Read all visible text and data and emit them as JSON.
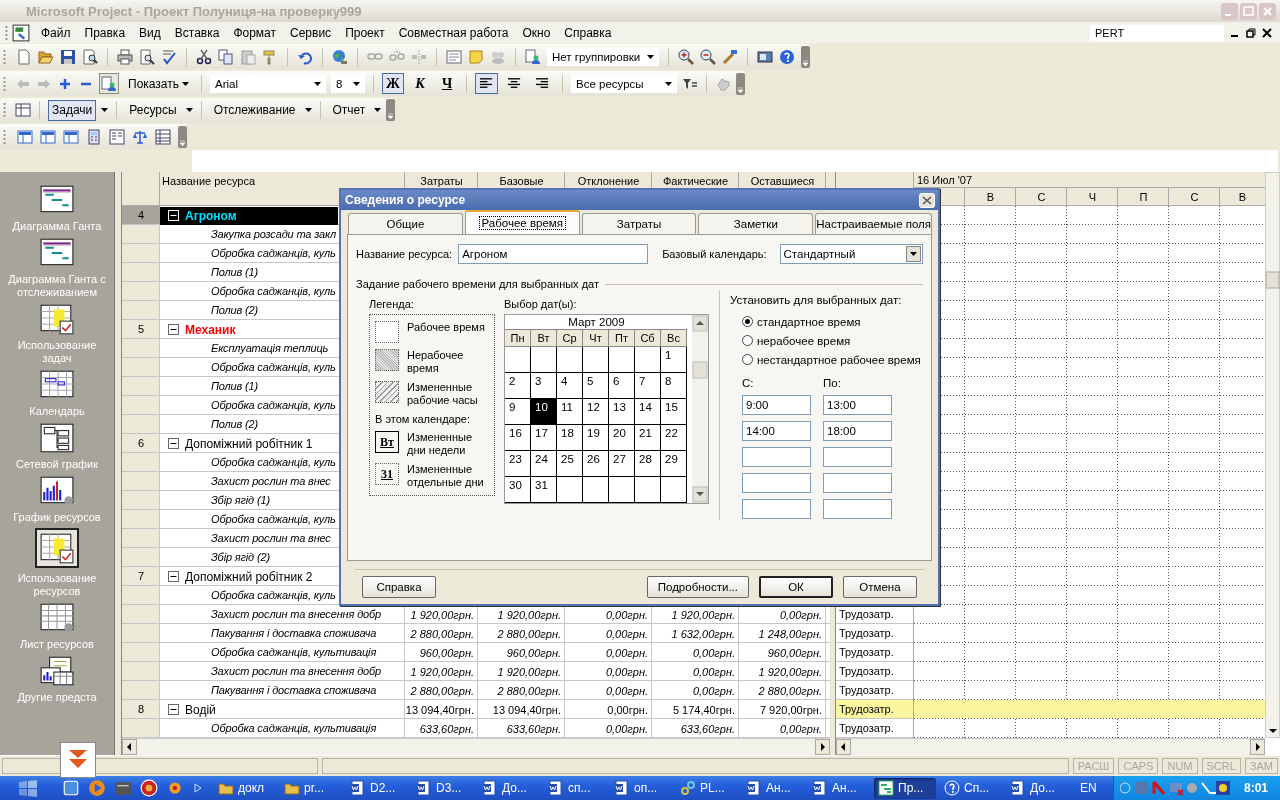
{
  "window": {
    "title": "Microsoft Project - Проект Полуниця-на проверку999"
  },
  "menu": [
    "Файл",
    "Правка",
    "Вид",
    "Вставка",
    "Формат",
    "Сервис",
    "Проект",
    "Совместная работа",
    "Окно",
    "Справка"
  ],
  "help_box": {
    "value": "PERT"
  },
  "toolbars": {
    "grouping": {
      "value": "Нет группировки"
    },
    "show_button": "Показать",
    "font": {
      "value": "Arial"
    },
    "font_size": {
      "value": "8"
    },
    "format_buttons": [
      {
        "label": "Ж",
        "kind": "bold",
        "pressed": true
      },
      {
        "label": "К",
        "kind": "italic",
        "pressed": false
      },
      {
        "label": "Ч",
        "kind": "underline",
        "pressed": false
      }
    ],
    "align_buttons": [
      {
        "kind": "left",
        "pressed": true
      },
      {
        "kind": "center",
        "pressed": false
      },
      {
        "kind": "right",
        "pressed": false
      }
    ],
    "filter": {
      "value": "Все ресурсы"
    },
    "guide_buttons": [
      {
        "label": "Задачи",
        "selected": true
      },
      {
        "label": "Ресурсы",
        "selected": false
      },
      {
        "label": "Отслеживание",
        "selected": false
      },
      {
        "label": "Отчет",
        "selected": false
      }
    ]
  },
  "view_bar": {
    "items": [
      {
        "label": "Диаграмма Ганта",
        "kind": "gantt",
        "selected": false
      },
      {
        "label": "Диаграмма Ганта с отслеживанием",
        "kind": "gantt",
        "selected": false
      },
      {
        "label": "Использование задач",
        "kind": "usage",
        "selected": false
      },
      {
        "label": "Календарь",
        "kind": "calendar",
        "selected": false
      },
      {
        "label": "Сетевой график",
        "kind": "network",
        "selected": false
      },
      {
        "label": "График ресурсов",
        "kind": "graph",
        "selected": false
      },
      {
        "label": "Использование ресурсов",
        "kind": "usage",
        "selected": true
      },
      {
        "label": "Лист ресурсов",
        "kind": "sheet",
        "selected": false
      },
      {
        "label": "Другие предста",
        "kind": "other",
        "selected": false
      }
    ]
  },
  "sheet": {
    "columns": [
      "Название ресурса",
      "Затраты",
      "Базовые",
      "Отклонение",
      "Фактические",
      "Оставшиеся"
    ],
    "rows": [
      {
        "kind": "resource",
        "number": "4",
        "name": "Агроном",
        "selected": true,
        "overallocated": true,
        "highlighted": false
      },
      {
        "kind": "assignment",
        "name": "Закупка розсади та закл",
        "selected": false,
        "highlighted": false
      },
      {
        "kind": "assignment",
        "name": "Обробка саджанців, куль",
        "selected": false,
        "highlighted": false
      },
      {
        "kind": "assignment",
        "name": "Полив (1)",
        "selected": false,
        "highlighted": false
      },
      {
        "kind": "assignment",
        "name": "Обробка саджанців, куль",
        "selected": false,
        "highlighted": false
      },
      {
        "kind": "assignment",
        "name": "Полив  (2)",
        "selected": false,
        "highlighted": false
      },
      {
        "kind": "resource",
        "number": "5",
        "name": "Механик",
        "selected": false,
        "overallocated": true,
        "highlighted": false
      },
      {
        "kind": "assignment",
        "name": "Експлуатація теплиць",
        "selected": false,
        "highlighted": false
      },
      {
        "kind": "assignment",
        "name": "Обробка саджанців, куль",
        "selected": false,
        "highlighted": false
      },
      {
        "kind": "assignment",
        "name": "Полив (1)",
        "selected": false,
        "highlighted": false
      },
      {
        "kind": "assignment",
        "name": "Обробка саджанців, куль",
        "selected": false,
        "highlighted": false
      },
      {
        "kind": "assignment",
        "name": "Полив  (2)",
        "selected": false,
        "highlighted": false
      },
      {
        "kind": "resource",
        "number": "6",
        "name": "Допоміжний робітник 1",
        "selected": false,
        "overallocated": false,
        "highlighted": false
      },
      {
        "kind": "assignment",
        "name": "Обробка саджанців, куль",
        "selected": false,
        "highlighted": false
      },
      {
        "kind": "assignment",
        "name": "Захист рослин та внес",
        "selected": false,
        "highlighted": false
      },
      {
        "kind": "assignment",
        "name": "Збір ягід (1)",
        "selected": false,
        "highlighted": false
      },
      {
        "kind": "assignment",
        "name": "Обробка саджанців, куль",
        "selected": false,
        "highlighted": false
      },
      {
        "kind": "assignment",
        "name": "Захист рослин та внес",
        "selected": false,
        "highlighted": false
      },
      {
        "kind": "assignment",
        "name": "Збір ягід  (2)",
        "selected": false,
        "highlighted": false
      },
      {
        "kind": "resource",
        "number": "7",
        "name": "Допоміжний робітник 2",
        "selected": false,
        "overallocated": false,
        "highlighted": false
      },
      {
        "kind": "assignment",
        "name": "Обробка саджанців, куль",
        "selected": false,
        "highlighted": false
      },
      {
        "kind": "assignment",
        "name": "Захист рослин та внесення добр",
        "selected": false,
        "values": [
          "1 920,00грн.",
          "1 920,00грн.",
          "0,00грн.",
          "1 920,00грн.",
          "0,00грн."
        ],
        "work": "Трудозатр.",
        "highlighted": false
      },
      {
        "kind": "assignment",
        "name": "Пакування  і доставка споживача",
        "selected": false,
        "values": [
          "2 880,00грн.",
          "2 880,00грн.",
          "0,00грн.",
          "1 632,00грн.",
          "1 248,00грн."
        ],
        "work": "Трудозатр.",
        "highlighted": false
      },
      {
        "kind": "assignment",
        "name": "Обробка саджанців, культивація",
        "selected": false,
        "values": [
          "960,00грн.",
          "960,00грн.",
          "0,00грн.",
          "0,00грн.",
          "960,00грн."
        ],
        "work": "Трудозатр.",
        "highlighted": false
      },
      {
        "kind": "assignment",
        "name": "Захист рослин та внесення добр",
        "selected": false,
        "values": [
          "1 920,00грн.",
          "1 920,00грн.",
          "0,00грн.",
          "0,00грн.",
          "1 920,00грн."
        ],
        "work": "Трудозатр.",
        "highlighted": false
      },
      {
        "kind": "assignment",
        "name": "Пакування  і доставка споживача",
        "selected": false,
        "values": [
          "2 880,00грн.",
          "2 880,00грн.",
          "0,00грн.",
          "0,00грн.",
          "2 880,00грн."
        ],
        "work": "Трудозатр.",
        "highlighted": false
      },
      {
        "kind": "resource",
        "number": "8",
        "name": "Водій",
        "selected": false,
        "overallocated": false,
        "values": [
          "13 094,40грн.",
          "13 094,40грн.",
          "0,00грн.",
          "5 174,40грн.",
          "7 920,00грн."
        ],
        "work": "Трудозатр.",
        "highlighted": true
      },
      {
        "kind": "assignment",
        "name": "Обробка саджанців, культивація",
        "selected": false,
        "values": [
          "633,60грн.",
          "633,60грн.",
          "0,00грн.",
          "633,60грн.",
          "0,00грн."
        ],
        "work": "Трудозатр.",
        "highlighted": false
      }
    ]
  },
  "usage": {
    "date": "16 Июл '07",
    "days": [
      "В",
      "С",
      "Ч",
      "П",
      "С",
      "В"
    ]
  },
  "dialog": {
    "title": "Сведения о ресурсе",
    "tabs": [
      {
        "label": "Общие",
        "selected": false
      },
      {
        "label": "Рабочее время",
        "selected": true
      },
      {
        "label": "Затраты",
        "selected": false
      },
      {
        "label": "Заметки",
        "selected": false
      },
      {
        "label": "Настраиваемые поля",
        "selected": false
      }
    ],
    "resource_name": {
      "label": "Название ресурса:",
      "value": "Агроном"
    },
    "base_calendar": {
      "label": "Базовый календарь:",
      "value": "Стандартный"
    },
    "group_title": "Задание рабочего времени для выбранных дат",
    "legend": {
      "title": "Легенда:",
      "items": [
        {
          "kind": "working",
          "label": "Рабочее время"
        },
        {
          "kind": "nonworking",
          "label": "Нерабочее время"
        },
        {
          "kind": "changed",
          "label": "Измененные рабочие часы"
        }
      ],
      "subtitle": "В этом календаре:",
      "samples": [
        {
          "kind": "weekday",
          "mark": "Вт",
          "label": "Измененные дни недели"
        },
        {
          "kind": "day",
          "mark": "31",
          "label": "Измененные отдельные дни"
        }
      ]
    },
    "calendar": {
      "title": "Выбор дат(ы):",
      "month": "Март 2009",
      "weekdays": [
        "Пн",
        "Вт",
        "Ср",
        "Чт",
        "Пт",
        "Сб",
        "Вс"
      ],
      "weeks": [
        [
          {
            "kind": "blank"
          },
          {
            "kind": "blank"
          },
          {
            "kind": "blank"
          },
          {
            "kind": "blank"
          },
          {
            "kind": "blank"
          },
          {
            "kind": "blank"
          },
          {
            "kind": "day",
            "day": "1",
            "selected": false
          }
        ],
        [
          {
            "kind": "day",
            "day": "2",
            "selected": false
          },
          {
            "kind": "day",
            "day": "3",
            "selected": false
          },
          {
            "kind": "day",
            "day": "4",
            "selected": false
          },
          {
            "kind": "day",
            "day": "5",
            "selected": false
          },
          {
            "kind": "day",
            "day": "6",
            "selected": false
          },
          {
            "kind": "day",
            "day": "7",
            "selected": false
          },
          {
            "kind": "day",
            "day": "8",
            "selected": false
          }
        ],
        [
          {
            "kind": "day",
            "day": "9",
            "selected": false
          },
          {
            "kind": "day",
            "day": "10",
            "selected": true
          },
          {
            "kind": "day",
            "day": "11",
            "selected": false
          },
          {
            "kind": "day",
            "day": "12",
            "selected": false
          },
          {
            "kind": "day",
            "day": "13",
            "selected": false
          },
          {
            "kind": "day",
            "day": "14",
            "selected": false
          },
          {
            "kind": "day",
            "day": "15",
            "selected": false
          }
        ],
        [
          {
            "kind": "day",
            "day": "16",
            "selected": false
          },
          {
            "kind": "day",
            "day": "17",
            "selected": false
          },
          {
            "kind": "day",
            "day": "18",
            "selected": false
          },
          {
            "kind": "day",
            "day": "19",
            "selected": false
          },
          {
            "kind": "day",
            "day": "20",
            "selected": false
          },
          {
            "kind": "day",
            "day": "21",
            "selected": false
          },
          {
            "kind": "day",
            "day": "22",
            "selected": false
          }
        ],
        [
          {
            "kind": "day",
            "day": "23",
            "selected": false
          },
          {
            "kind": "day",
            "day": "24",
            "selected": false
          },
          {
            "kind": "day",
            "day": "25",
            "selected": false
          },
          {
            "kind": "day",
            "day": "26",
            "selected": false
          },
          {
            "kind": "day",
            "day": "27",
            "selected": false
          },
          {
            "kind": "day",
            "day": "28",
            "selected": false
          },
          {
            "kind": "day",
            "day": "29",
            "selected": false
          }
        ],
        [
          {
            "kind": "day",
            "day": "30",
            "selected": false
          },
          {
            "kind": "day",
            "day": "31",
            "selected": false
          },
          {
            "kind": "blank"
          },
          {
            "kind": "blank"
          },
          {
            "kind": "blank"
          },
          {
            "kind": "blank"
          },
          {
            "kind": "blank"
          }
        ]
      ]
    },
    "set_for": {
      "title": "Установить для выбранных дат:",
      "options": [
        {
          "label": "стандартное время",
          "selected": true
        },
        {
          "label": "нерабочее время",
          "selected": false
        },
        {
          "label": "нестандартное рабочее время",
          "selected": false
        }
      ],
      "from_label": "С:",
      "to_label": "По:",
      "times": [
        {
          "kind": "filled",
          "from": "9:00",
          "to": "13:00"
        },
        {
          "kind": "filled",
          "from": "14:00",
          "to": "18:00"
        },
        {
          "kind": "blank"
        },
        {
          "kind": "blank"
        },
        {
          "kind": "blank"
        }
      ]
    },
    "buttons": [
      {
        "kind": "help",
        "label": "Справка"
      },
      {
        "kind": "details",
        "label": "Подробности..."
      },
      {
        "kind": "default",
        "label": "ОК"
      },
      {
        "kind": "cancel",
        "label": "Отмена"
      }
    ]
  },
  "status_bar": {
    "indicators": [
      {
        "label": "РАСШ",
        "on": false
      },
      {
        "label": "CAPS",
        "on": false
      },
      {
        "label": "NUM",
        "on": false
      },
      {
        "label": "SCRL",
        "on": false
      },
      {
        "label": "ЗАМ",
        "on": false
      }
    ]
  },
  "taskbar": {
    "tasks": [
      {
        "label": "докл",
        "kind": "folder",
        "selected": false
      },
      {
        "label": "pr...",
        "kind": "folder",
        "selected": false
      },
      {
        "label": "D2...",
        "kind": "word",
        "selected": false
      },
      {
        "label": "D3...",
        "kind": "word",
        "selected": false
      },
      {
        "label": "До...",
        "kind": "word",
        "selected": false
      },
      {
        "label": "сп...",
        "kind": "word",
        "selected": false
      },
      {
        "label": "оп...",
        "kind": "word",
        "selected": false
      },
      {
        "label": "PL...",
        "kind": "chain",
        "selected": false
      },
      {
        "label": "Ан...",
        "kind": "word",
        "selected": false
      },
      {
        "label": "Ан...",
        "kind": "word",
        "selected": false
      },
      {
        "label": "Пр...",
        "kind": "project",
        "selected": true
      },
      {
        "label": "Сп...",
        "kind": "help",
        "selected": false
      },
      {
        "label": "До...",
        "kind": "word",
        "selected": false
      }
    ],
    "language": "EN",
    "clock": "8:01"
  }
}
